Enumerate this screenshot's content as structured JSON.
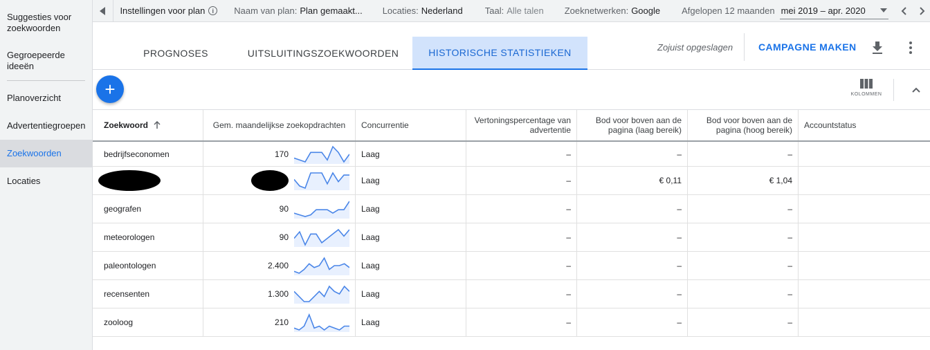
{
  "sidebar": {
    "items": [
      {
        "label": "Suggesties voor zoekwoorden",
        "name": "sidebar-item-suggesties"
      },
      {
        "label": "Gegroepeerde ideeën",
        "name": "sidebar-item-gegroepeerde-ideeen"
      },
      {
        "label": "Planoverzicht",
        "name": "sidebar-item-planoverzicht"
      },
      {
        "label": "Advertentiegroepen",
        "name": "sidebar-item-advertentiegroepen"
      },
      {
        "label": "Zoekwoorden",
        "name": "sidebar-item-zoekwoorden",
        "active": true
      },
      {
        "label": "Locaties",
        "name": "sidebar-item-locaties"
      }
    ]
  },
  "topbar": {
    "settings_label": "Instellingen voor plan",
    "plan_name_label": "Naam van plan:",
    "plan_name_value": "Plan gemaakt...",
    "locations_label": "Locaties:",
    "locations_value": "Nederland",
    "language_label": "Taal:",
    "language_value": "Alle talen",
    "networks_label": "Zoeknetwerken:",
    "networks_value": "Google",
    "period_label": "Afgelopen 12 maanden",
    "date_range": "mei 2019 – apr. 2020"
  },
  "tabs": [
    {
      "label": "PROGNOSES"
    },
    {
      "label": "UITSLUITINGSZOEKWOORDEN"
    },
    {
      "label": "HISTORISCHE STATISTIEKEN",
      "active": true
    }
  ],
  "header": {
    "saved_text": "Zojuist opgeslagen",
    "campaign_button": "CAMPAGNE MAKEN"
  },
  "toolbar": {
    "columns_label": "KOLOMMEN"
  },
  "table": {
    "headers": {
      "keyword": "Zoekwoord",
      "searches": "Gem. maandelijkse zoekopdrachten",
      "competition": "Concurrentie",
      "impression": "Vertoningspercentage van advertentie",
      "bid_low": "Bod voor boven aan de pagina (laag bereik)",
      "bid_high": "Bod voor boven aan de pagina (hoog bereik)",
      "account": "Accountstatus"
    },
    "rows": [
      {
        "keyword": "bedrijfseconomen",
        "searches": "170",
        "competition": "Laag",
        "impression": "–",
        "bid_low": "–",
        "bid_high": "–",
        "account": "",
        "trend": [
          3,
          2,
          1,
          6,
          6,
          6,
          2,
          9,
          6,
          1,
          5
        ]
      },
      {
        "keyword": "",
        "redacted": true,
        "searches": "",
        "competition": "Laag",
        "impression": "–",
        "bid_low": "€ 0,11",
        "bid_high": "€ 1,04",
        "account": "",
        "trend": [
          5,
          2,
          1,
          8,
          8,
          8,
          3,
          8,
          4,
          7,
          7
        ]
      },
      {
        "keyword": "geografen",
        "searches": "90",
        "competition": "Laag",
        "impression": "–",
        "bid_low": "–",
        "bid_high": "–",
        "account": "",
        "trend": [
          2,
          1,
          0,
          1,
          4,
          4,
          4,
          2,
          4,
          4,
          9
        ]
      },
      {
        "keyword": "meteorologen",
        "searches": "90",
        "competition": "Laag",
        "impression": "–",
        "bid_low": "–",
        "bid_high": "–",
        "account": "",
        "trend": [
          4,
          7,
          1,
          6,
          6,
          2,
          4,
          6,
          8,
          5,
          8
        ]
      },
      {
        "keyword": "paleontologen",
        "searches": "2.400",
        "competition": "Laag",
        "impression": "–",
        "bid_low": "–",
        "bid_high": "–",
        "account": "",
        "trend": [
          2,
          1,
          3,
          6,
          4,
          5,
          9,
          3,
          5,
          5,
          6,
          4
        ]
      },
      {
        "keyword": "recensenten",
        "searches": "1.300",
        "competition": "Laag",
        "impression": "–",
        "bid_low": "–",
        "bid_high": "–",
        "account": "",
        "trend": [
          5,
          3,
          1,
          1,
          3,
          5,
          3,
          7,
          5,
          4,
          7,
          5
        ]
      },
      {
        "keyword": "zooloog",
        "searches": "210",
        "competition": "Laag",
        "impression": "–",
        "bid_low": "–",
        "bid_high": "–",
        "account": "",
        "trend": [
          2,
          1,
          3,
          9,
          2,
          3,
          1,
          3,
          2,
          1,
          3,
          3
        ]
      }
    ]
  },
  "colors": {
    "accent": "#1a73e8",
    "spark_line": "#4a86e8",
    "spark_fill": "#e8f0fe"
  }
}
